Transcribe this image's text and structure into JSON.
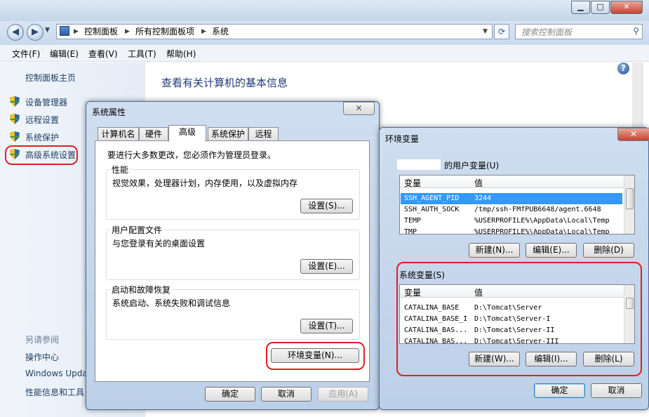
{
  "explorer": {
    "window_controls": [
      "▁",
      "□",
      "✕"
    ],
    "breadcrumb": [
      "控制面板",
      "所有控制面板项",
      "系统"
    ],
    "search_placeholder": "搜索控制面板",
    "menu": [
      "文件(F)",
      "编辑(E)",
      "查看(V)",
      "工具(T)",
      "帮助(H)"
    ],
    "left_top": "控制面板主页",
    "left_links": [
      "设备管理器",
      "远程设置",
      "系统保护",
      "高级系统设置"
    ],
    "see_also_heading": "另请参阅",
    "see_also": [
      "操作中心",
      "Windows Upda",
      "性能信息和工具"
    ],
    "page_title": "查看有关计算机的基本信息",
    "help": "?"
  },
  "sysprops": {
    "title": "系统属性",
    "tabs": [
      "计算机名",
      "硬件",
      "高级",
      "系统保护",
      "远程"
    ],
    "active_tab": "高级",
    "admin_note": "要进行大多数更改，您必须作为管理员登录。",
    "groups": [
      {
        "label": "性能",
        "desc": "视觉效果，处理器计划，内存使用，以及虚拟内存",
        "button": "设置(S)..."
      },
      {
        "label": "用户配置文件",
        "desc": "与您登录有关的桌面设置",
        "button": "设置(E)..."
      },
      {
        "label": "启动和故障恢复",
        "desc": "系统启动、系统失败和调试信息",
        "button": "设置(T)..."
      }
    ],
    "env_button": "环境变量(N)...",
    "ok": "确定",
    "cancel": "取消",
    "apply": "应用(A)"
  },
  "envvars": {
    "title": "环境变量",
    "user_section_label": "的用户变量(U)",
    "col_var": "变量",
    "col_val": "值",
    "user_vars": [
      {
        "name": "SSH_AGENT_PID",
        "value": "3244"
      },
      {
        "name": "SSH_AUTH_SOCK",
        "value": "/tmp/ssh-FMfPUB6648/agent.6648"
      },
      {
        "name": "TEMP",
        "value": "%USERPROFILE%\\AppData\\Local\\Temp"
      },
      {
        "name": "TMP",
        "value": "%USERPROFILE%\\AppData\\Local\\Temp"
      }
    ],
    "user_buttons": [
      "新建(N)...",
      "编辑(E)...",
      "删除(D)"
    ],
    "system_section_label": "系统变量(S)",
    "system_vars": [
      {
        "name": "CATALINA_BASE",
        "value": "D:\\Tomcat\\Server"
      },
      {
        "name": "CATALINA_BASE_I",
        "value": "D:\\Tomcat\\Server-I"
      },
      {
        "name": "CATALINA_BAS...",
        "value": "D:\\Tomcat\\Server-II"
      },
      {
        "name": "CATALINA_BAS...",
        "value": "D:\\Tomcat\\Server-III"
      }
    ],
    "system_buttons": [
      "新建(W)...",
      "编辑(I)...",
      "删除(L)"
    ],
    "ok": "确定",
    "cancel": "取消"
  },
  "colors": {
    "highlight": "#e02020",
    "selection": "#3399ff",
    "link": "#1e3f66",
    "title_text": "#1e3a7a"
  }
}
